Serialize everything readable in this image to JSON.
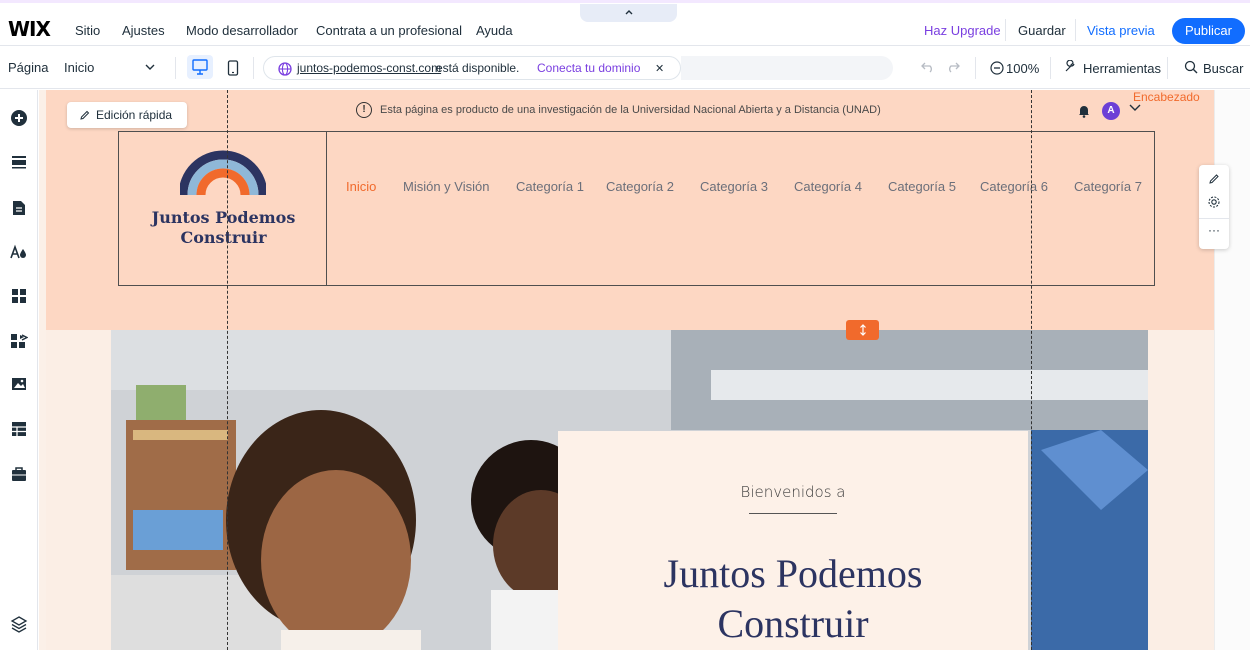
{
  "menubar": {
    "logo": "WIX",
    "items": [
      "Sitio",
      "Ajustes",
      "Modo desarrollador",
      "Contrata a un profesional",
      "Ayuda"
    ],
    "upgrade": "Haz Upgrade",
    "save": "Guardar",
    "preview": "Vista previa",
    "publish": "Publicar"
  },
  "toolbar": {
    "page_label": "Página",
    "page_value": "Inicio",
    "domain": "juntos-podemos-const.com",
    "domain_status": "está disponible.",
    "connect": "Conecta tu dominio",
    "zoom": "100%",
    "tools": "Herramientas",
    "search": "Buscar"
  },
  "canvas": {
    "quick_edit": "Edición rápida",
    "announcement": "Esta página es producto de una investigación de la Universidad Nacional Abierta y a Distancia (UNAD)",
    "section_tag": "Encabezado",
    "avatar_letter": "A",
    "site_title_line1": "Juntos Podemos",
    "site_title_line2": "Construir",
    "nav": [
      "Inicio",
      "Misión y Visión",
      "Categoría 1",
      "Categoría 2",
      "Categoría 3",
      "Categoría 4",
      "Categoría 5",
      "Categoría 6",
      "Categoría 7"
    ],
    "welcome_small": "Bienvenidos a",
    "welcome_big_line1": "Juntos Podemos",
    "welcome_big_line2": "Construir"
  },
  "colors": {
    "accent_blue": "#116dff",
    "upgrade_purple": "#7a3fe0",
    "header_bg": "#fdd7c3",
    "orange": "#f16a2c",
    "navy": "#2c3461"
  }
}
